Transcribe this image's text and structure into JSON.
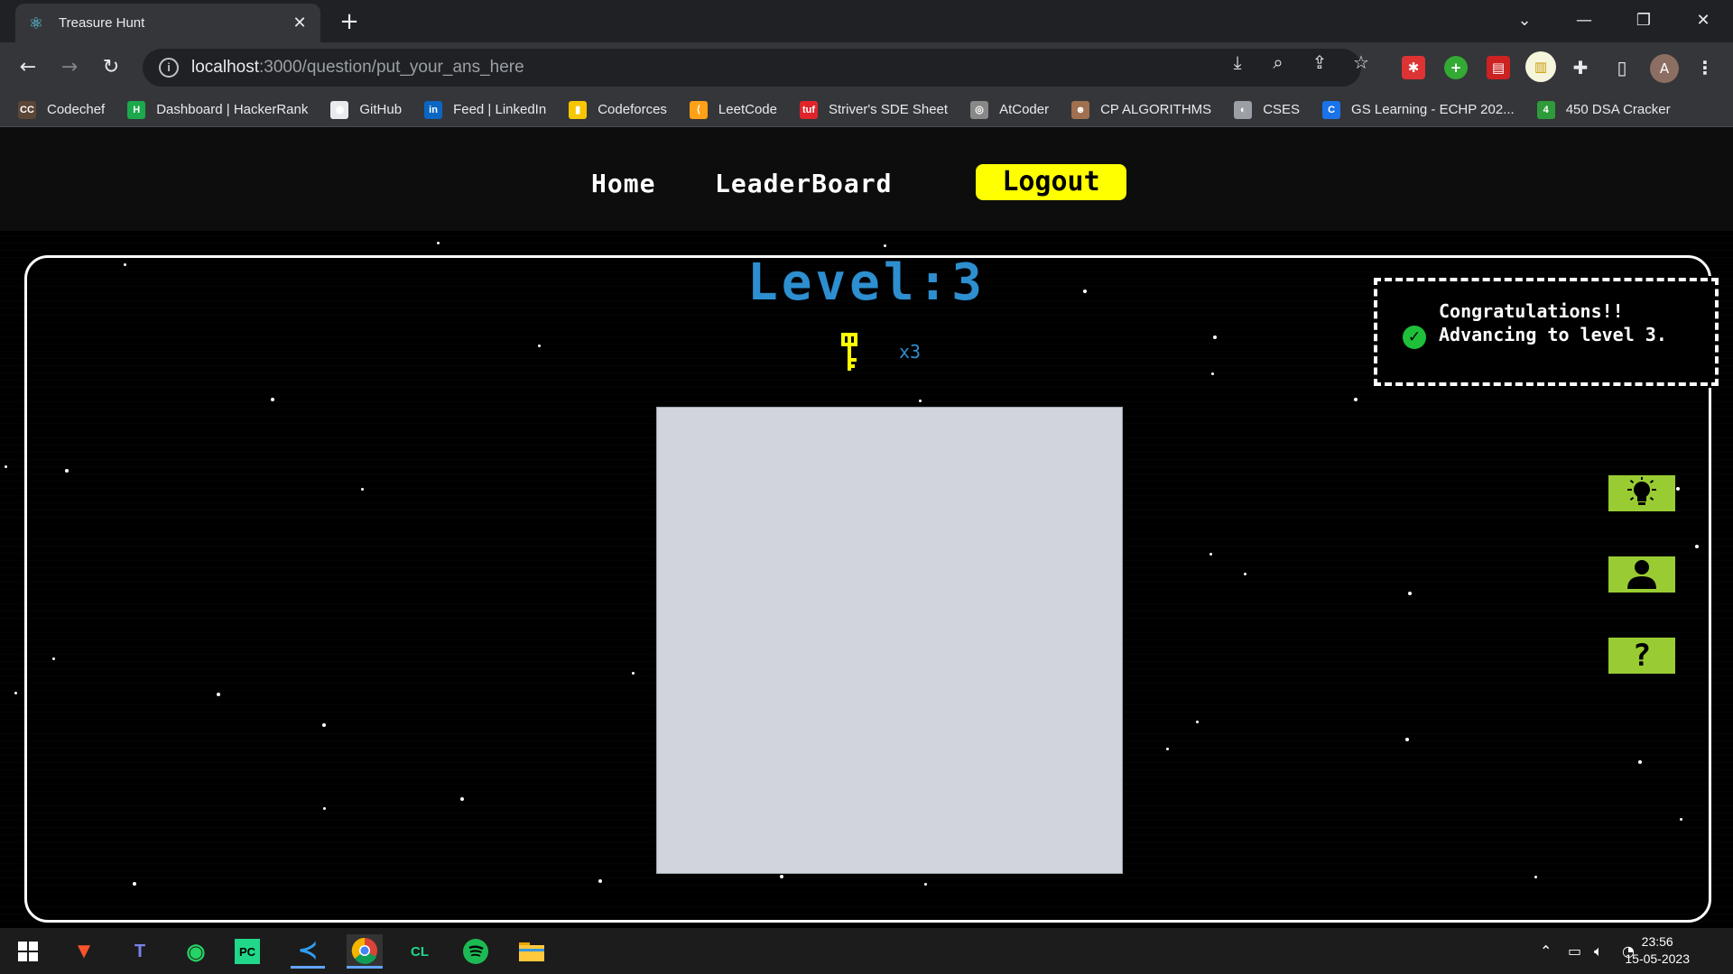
{
  "browser": {
    "tab_title": "Treasure Hunt",
    "new_tab_label": "+",
    "url_host": "localhost",
    "url_path": ":3000/question/put_your_ans_here",
    "profile_initial": "A",
    "bookmarks": [
      {
        "label": "Codechef",
        "icon": "CC",
        "color": "#5b4638"
      },
      {
        "label": "Dashboard | HackerRank",
        "icon": "H",
        "color": "#1ba94c"
      },
      {
        "label": "GitHub",
        "icon": "◉",
        "color": "#e8eaed"
      },
      {
        "label": "Feed | LinkedIn",
        "icon": "in",
        "color": "#0a66c2"
      },
      {
        "label": "Codeforces",
        "icon": "▮",
        "color": "#f7c600"
      },
      {
        "label": "LeetCode",
        "icon": "⟨",
        "color": "#ffa116"
      },
      {
        "label": "Striver's SDE Sheet",
        "icon": "tuf",
        "color": "#e0242a"
      },
      {
        "label": "AtCoder",
        "icon": "◎",
        "color": "#888888"
      },
      {
        "label": "CP ALGORITHMS",
        "icon": "☻",
        "color": "#a07050"
      },
      {
        "label": "CSES",
        "icon": "◐",
        "color": "#9aa0a6"
      },
      {
        "label": "GS Learning - ECHP 202...",
        "icon": "C",
        "color": "#1a73e8"
      },
      {
        "label": "450 DSA Cracker",
        "icon": "4",
        "color": "#2e9b3b"
      }
    ]
  },
  "nav": {
    "home": "Home",
    "leaderboard": "LeaderBoard",
    "logout": "Logout"
  },
  "game": {
    "level_text": "Level:3",
    "key_count": "x3"
  },
  "toast": {
    "message": "Congratulations!! Advancing to level 3."
  },
  "side_buttons": [
    {
      "name": "hint-button",
      "icon": "lightbulb-icon"
    },
    {
      "name": "profile-button",
      "icon": "user-icon"
    },
    {
      "name": "help-button",
      "icon": "question-icon"
    }
  ],
  "taskbar": {
    "time": "23:56",
    "date": "15-05-2023",
    "apps": [
      "windows-start",
      "brave",
      "teams",
      "whatsapp",
      "pycharm",
      "vscode",
      "chrome",
      "clion",
      "spotify",
      "file-explorer"
    ]
  },
  "colors": {
    "accent_yellow": "#ffff00",
    "level_blue": "#2d8fd0",
    "side_button_green": "#99cc33"
  }
}
